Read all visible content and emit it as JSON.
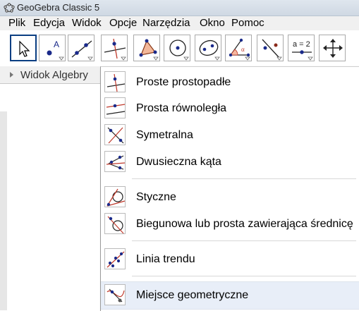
{
  "window": {
    "title": "GeoGebra Classic 5"
  },
  "menu": [
    "Plik",
    "Edycja",
    "Widok",
    "Opcje",
    "Narzędzia",
    "Okno",
    "Pomoc"
  ],
  "algebra_view": {
    "label": "Widok Algebry"
  },
  "toolbar": {
    "tools": [
      {
        "icon": "move-arrow-icon",
        "selected": true
      },
      {
        "icon": "point-icon"
      },
      {
        "icon": "line-through-two-points-icon"
      },
      {
        "icon": "perpendicular-line-icon"
      },
      {
        "icon": "polygon-icon"
      },
      {
        "icon": "circle-center-point-icon"
      },
      {
        "icon": "ellipse-icon"
      },
      {
        "icon": "angle-icon"
      },
      {
        "icon": "reflect-about-line-icon"
      },
      {
        "icon": "slider-icon",
        "text": "a = 2"
      },
      {
        "icon": "move-graphics-view-icon"
      }
    ]
  },
  "dropdown": {
    "items": [
      {
        "label": "Proste prostopadłe"
      },
      {
        "label": "Prosta równoległa"
      },
      {
        "label": "Symetralna"
      },
      {
        "label": "Dwusieczna kąta"
      },
      {
        "label": "Styczne"
      },
      {
        "label": "Biegunowa lub prosta zawierająca średnicę"
      },
      {
        "label": "Linia trendu"
      },
      {
        "label": "Miejsce geometryczne",
        "highlighted": true
      }
    ]
  }
}
